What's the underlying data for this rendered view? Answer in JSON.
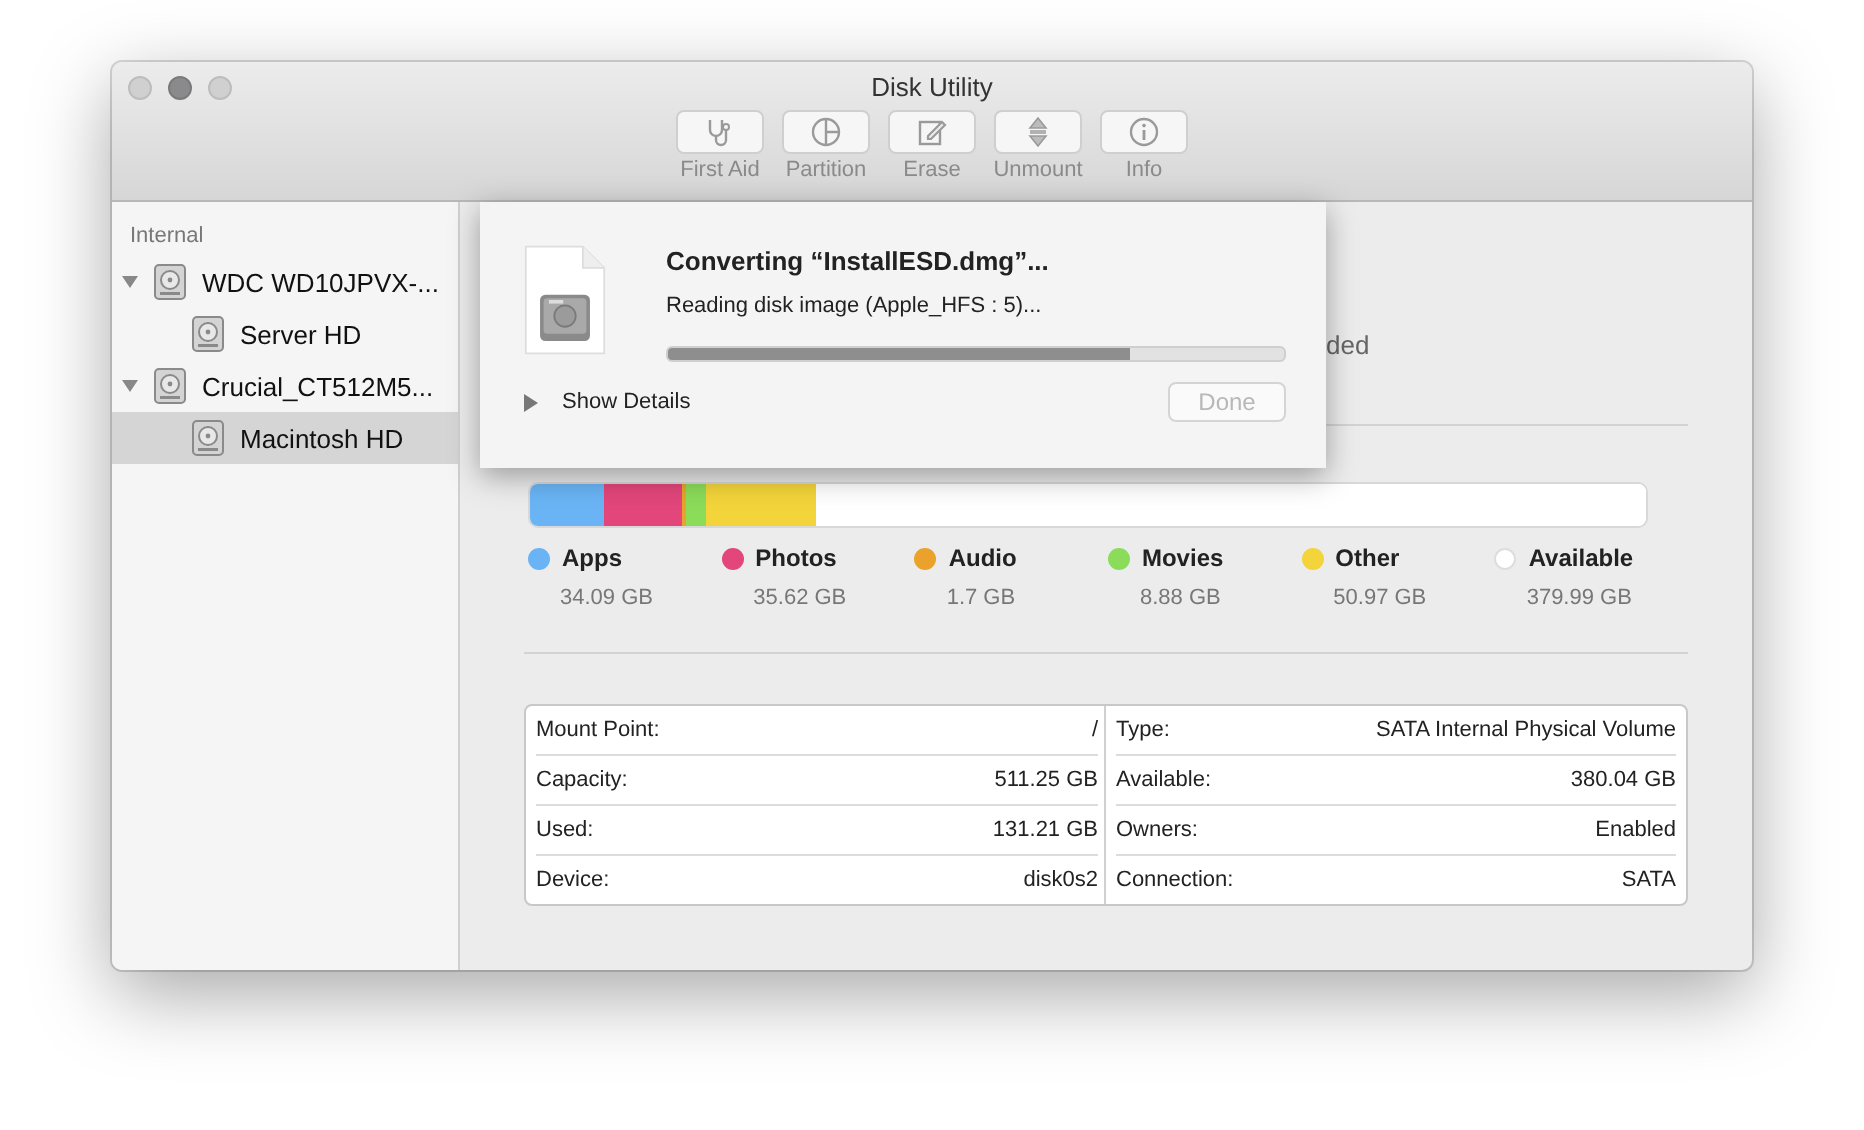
{
  "window": {
    "title": "Disk Utility"
  },
  "toolbar": {
    "buttons": [
      {
        "label": "First Aid"
      },
      {
        "label": "Partition"
      },
      {
        "label": "Erase"
      },
      {
        "label": "Unmount"
      },
      {
        "label": "Info"
      }
    ]
  },
  "sidebar": {
    "section": "Internal",
    "items": [
      {
        "label": "WDC WD10JPVX-...",
        "expanded": true,
        "selected": false,
        "children": [
          {
            "label": "Server HD",
            "selected": false
          }
        ]
      },
      {
        "label": "Crucial_CT512M5...",
        "expanded": true,
        "selected": false,
        "children": [
          {
            "label": "Macintosh HD",
            "selected": true
          }
        ]
      }
    ]
  },
  "volume_header": {
    "text": "ded"
  },
  "storage": {
    "segments": [
      {
        "name": "Apps",
        "value": "34.09 GB",
        "color": "#6ab4f5"
      },
      {
        "name": "Photos",
        "value": "35.62 GB",
        "color": "#e2467a"
      },
      {
        "name": "Audio",
        "value": "1.7 GB",
        "color": "#eaa22c"
      },
      {
        "name": "Movies",
        "value": "8.88 GB",
        "color": "#8bdc59"
      },
      {
        "name": "Other",
        "value": "50.97 GB",
        "color": "#f3d43a"
      },
      {
        "name": "Available",
        "value": "379.99 GB",
        "color": "#ffffff"
      }
    ]
  },
  "info": {
    "left": [
      {
        "label": "Mount Point:",
        "value": "/"
      },
      {
        "label": "Capacity:",
        "value": "511.25 GB"
      },
      {
        "label": "Used:",
        "value": "131.21 GB"
      },
      {
        "label": "Device:",
        "value": "disk0s2"
      }
    ],
    "right": [
      {
        "label": "Type:",
        "value": "SATA Internal Physical Volume"
      },
      {
        "label": "Available:",
        "value": "380.04 GB"
      },
      {
        "label": "Owners:",
        "value": "Enabled"
      },
      {
        "label": "Connection:",
        "value": "SATA"
      }
    ]
  },
  "sheet": {
    "title": "Converting “InstallESD.dmg”...",
    "status": "Reading disk image (Apple_HFS : 5)...",
    "progress": {
      "level": 0.75
    },
    "details": {
      "label": "Show Details",
      "expanded": false
    },
    "done_button": {
      "label": "Done",
      "disabled": true
    }
  }
}
